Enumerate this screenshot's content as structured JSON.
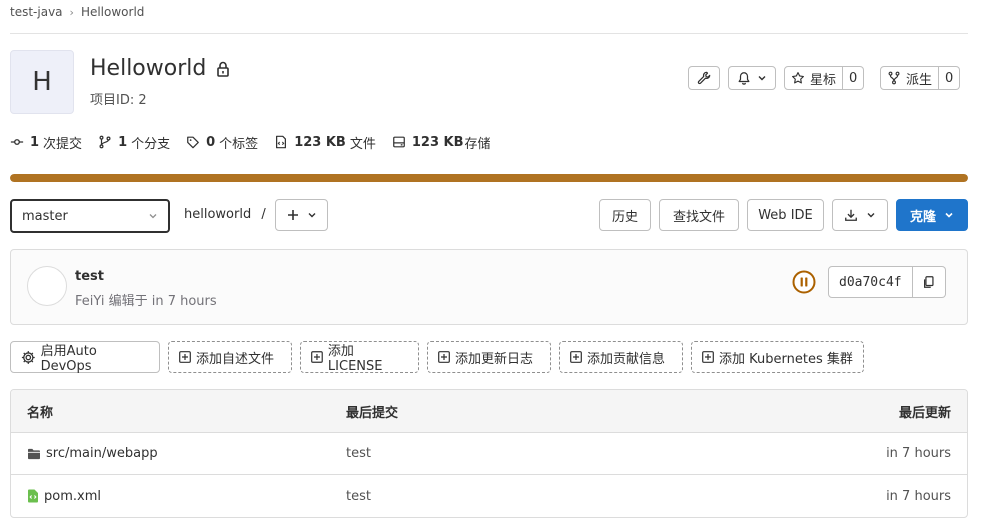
{
  "breadcrumb": {
    "namespace": "test-java",
    "sep": "›",
    "project": "Helloworld"
  },
  "project": {
    "avatar_letter": "H",
    "name": "Helloworld",
    "id_label": "项目ID: 2",
    "star_label": "星标",
    "star_count": "0",
    "fork_label": "派生",
    "fork_count": "0"
  },
  "stats": {
    "commits_count": "1",
    "commits_label": "次提交",
    "branches_count": "1",
    "branches_label": "个分支",
    "tags_count": "0",
    "tags_label": "个标签",
    "files_size": "123 KB",
    "files_label": "文件",
    "storage_size": "123 KB",
    "storage_label": "存储"
  },
  "storage_progress_percent": 100,
  "toolbar": {
    "branch": "master",
    "path": "helloworld",
    "path_sep": "/",
    "history": "历史",
    "find_file": "查找文件",
    "web_ide": "Web IDE",
    "clone": "克隆"
  },
  "last_commit": {
    "title": "test",
    "meta": "FeiYi 编辑于 in 7 hours",
    "sha": "d0a70c4f"
  },
  "quick_actions": {
    "auto_devops": "启用Auto DevOps",
    "add_readme": "添加自述文件",
    "add_license": "添加LICENSE",
    "add_changelog": "添加更新日志",
    "add_contributing": "添加贡献信息",
    "add_k8s": "添加 Kubernetes 集群"
  },
  "table": {
    "headers": {
      "name": "名称",
      "last_commit": "最后提交",
      "last_update": "最后更新"
    },
    "rows": [
      {
        "name": "src/main/webapp",
        "commit": "test",
        "updated": "in 7 hours",
        "icon": "folder-icon"
      },
      {
        "name": "pom.xml",
        "commit": "test",
        "updated": "in 7 hours",
        "icon": "file-code-icon"
      }
    ]
  },
  "colors": {
    "accent": "#1f75cb",
    "progress": "#b07322",
    "pipeline": "#ab6100"
  }
}
